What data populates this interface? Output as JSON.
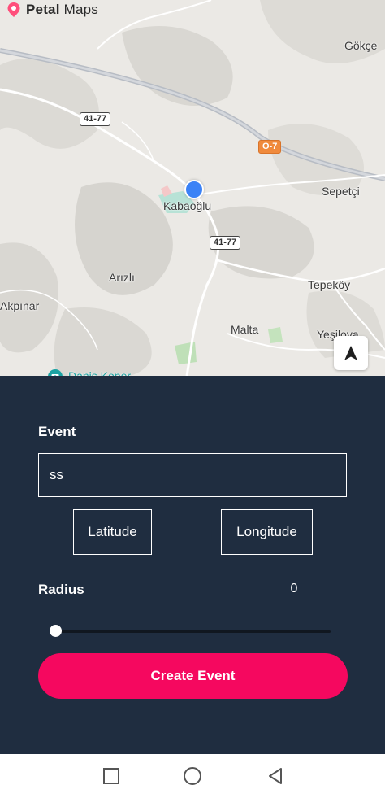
{
  "map": {
    "brand": {
      "name_bold": "Petal",
      "name_light": "Maps"
    },
    "places": [
      {
        "name": "Gökçe",
        "id": "gokce"
      },
      {
        "name": "Sepetçi",
        "id": "sepetci"
      },
      {
        "name": "Kabaoğlu",
        "id": "kabaoglu"
      },
      {
        "name": "Arızlı",
        "id": "arizli"
      },
      {
        "name": "Tepeköy",
        "id": "tepekoy"
      },
      {
        "name": "Akpınar",
        "id": "akpinar"
      },
      {
        "name": "Malta",
        "id": "malta"
      },
      {
        "name": "Yeşilova",
        "id": "yesilova"
      }
    ],
    "road_shields": {
      "r1": "41-77",
      "r2": "41-77",
      "highway": "O-7"
    },
    "poi_label": "Daniş Koper\nViyadüğü",
    "icons": {
      "locate": "navigation-arrow-icon",
      "poi": "viewpoint-pin-icon",
      "logo": "petal-pin-icon"
    }
  },
  "form": {
    "event_label": "Event",
    "event_value": "ss",
    "latitude_button": "Latitude",
    "longitude_button": "Longitude",
    "radius_label": "Radius",
    "radius_value": "0",
    "slider_value": 0,
    "create_button": "Create Event"
  },
  "colors": {
    "panel_bg": "#1f2d40",
    "accent": "#f5085f",
    "location_dot": "#3b82f6"
  },
  "navbar": {
    "icons": [
      "square-recents-icon",
      "circle-home-icon",
      "triangle-back-icon"
    ]
  }
}
